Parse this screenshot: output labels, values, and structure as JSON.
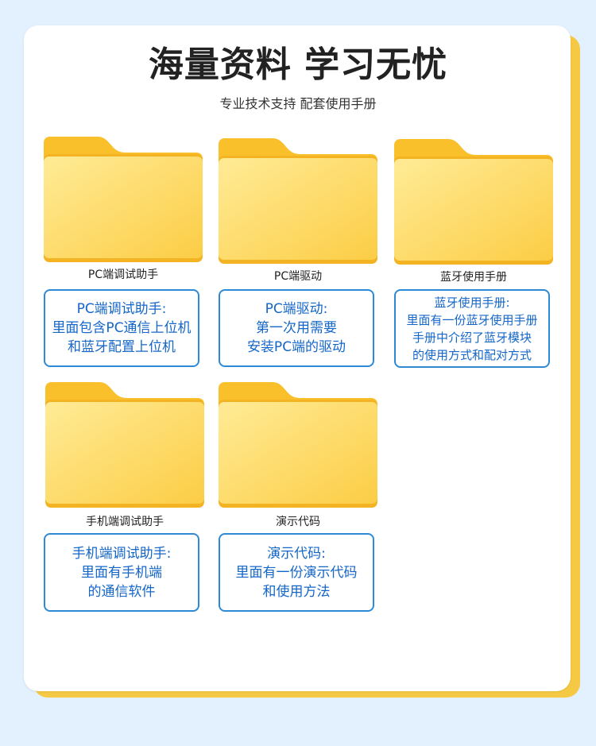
{
  "header": {
    "title": "海量资料 学习无忧",
    "subtitle": "专业技术支持 配套使用手册"
  },
  "colors": {
    "background": "#e2f1fd",
    "card": "#ffffff",
    "card_accent": "#f6c945",
    "folder_light": "#ffe98e",
    "folder_dark": "#f9c431",
    "desc_border": "#2d8ad6",
    "desc_text": "#1466c8"
  },
  "items": [
    {
      "label": "PC端调试助手",
      "desc": [
        "PC端调试助手:",
        "里面包含PC通信上位机",
        "和蓝牙配置上位机"
      ]
    },
    {
      "label": "PC端驱动",
      "desc": [
        "PC端驱动:",
        "第一次用需要",
        "安装PC端的驱动"
      ]
    },
    {
      "label": "蓝牙使用手册",
      "desc": [
        "蓝牙使用手册:",
        "里面有一份蓝牙使用手册",
        "手册中介绍了蓝牙模块",
        "的使用方式和配对方式"
      ]
    },
    {
      "label": "手机端调试助手",
      "desc": [
        "手机端调试助手:",
        "里面有手机端",
        "的通信软件"
      ]
    },
    {
      "label": "演示代码",
      "desc": [
        "演示代码:",
        "里面有一份演示代码",
        "和使用方法"
      ]
    }
  ]
}
